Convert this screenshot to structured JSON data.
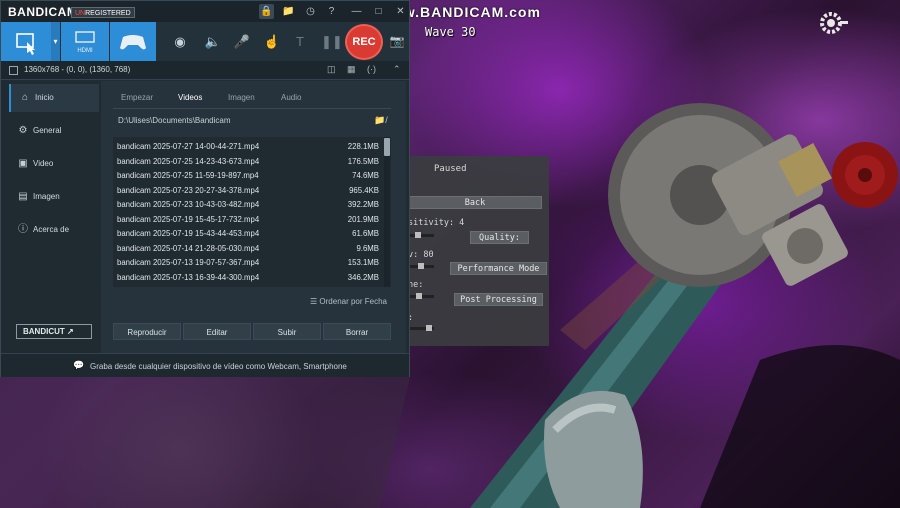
{
  "overlay": {
    "watermark": "www.BANDICAM.com",
    "wave": "Wave 30"
  },
  "pause_menu": {
    "title": "Paused",
    "back": "Back",
    "sensitivity_label": "sitivity: 4",
    "sensitivity_level": 0.35,
    "quality": "Quality:",
    "fov_label": "v: 80",
    "fov_level": 0.5,
    "performance_mode": "Performance Mode",
    "volume_label": "ne:",
    "volume_level": 0.4,
    "post_processing": "Post Processing",
    "misc_label": ":",
    "misc_level": 0.7
  },
  "bandicam": {
    "brand": "BANDICAM",
    "unregistered_prefix": "UN",
    "unregistered_rest": "REGISTERED",
    "rec_label": "REC",
    "hdmi_label": "HDMI",
    "resolution": "1360x768 - (0, 0), (1360, 768)",
    "sidebar": [
      {
        "label": "Inicio",
        "icon": "home-icon"
      },
      {
        "label": "General",
        "icon": "gear-icon"
      },
      {
        "label": "Video",
        "icon": "film-icon"
      },
      {
        "label": "Imagen",
        "icon": "image-icon"
      },
      {
        "label": "Acerca de",
        "icon": "info-icon"
      }
    ],
    "bandicut": "BANDICUT ↗",
    "tabs": [
      "Empezar",
      "Videos",
      "Imagen",
      "Audio"
    ],
    "active_tab": "Videos",
    "path": "D:\\Ulises\\Documents\\Bandicam",
    "path_suffix": "/",
    "files": [
      {
        "name": "bandicam 2025-07-27 14-00-44-271.mp4",
        "size": "228.1MB"
      },
      {
        "name": "bandicam 2025-07-25 14-23-43-673.mp4",
        "size": "176.5MB"
      },
      {
        "name": "bandicam 2025-07-25 11-59-19-897.mp4",
        "size": "74.6MB"
      },
      {
        "name": "bandicam 2025-07-23 20-27-34-378.mp4",
        "size": "965.4KB"
      },
      {
        "name": "bandicam 2025-07-23 10-43-03-482.mp4",
        "size": "392.2MB"
      },
      {
        "name": "bandicam 2025-07-19 15-45-17-732.mp4",
        "size": "201.9MB"
      },
      {
        "name": "bandicam 2025-07-19 15-43-44-453.mp4",
        "size": "61.6MB"
      },
      {
        "name": "bandicam 2025-07-14 21-28-05-030.mp4",
        "size": "9.6MB"
      },
      {
        "name": "bandicam 2025-07-13 19-07-57-367.mp4",
        "size": "153.1MB"
      },
      {
        "name": "bandicam 2025-07-13 16-39-44-300.mp4",
        "size": "346.2MB"
      }
    ],
    "sort_label": "Ordenar por Fecha",
    "actions": [
      "Reproducir",
      "Editar",
      "Subir",
      "Borrar"
    ],
    "status": "Graba desde cualquier dispositivo de vídeo como Webcam, Smartphone",
    "accent": "#2d8dd6",
    "rec_color": "#d93a32"
  }
}
